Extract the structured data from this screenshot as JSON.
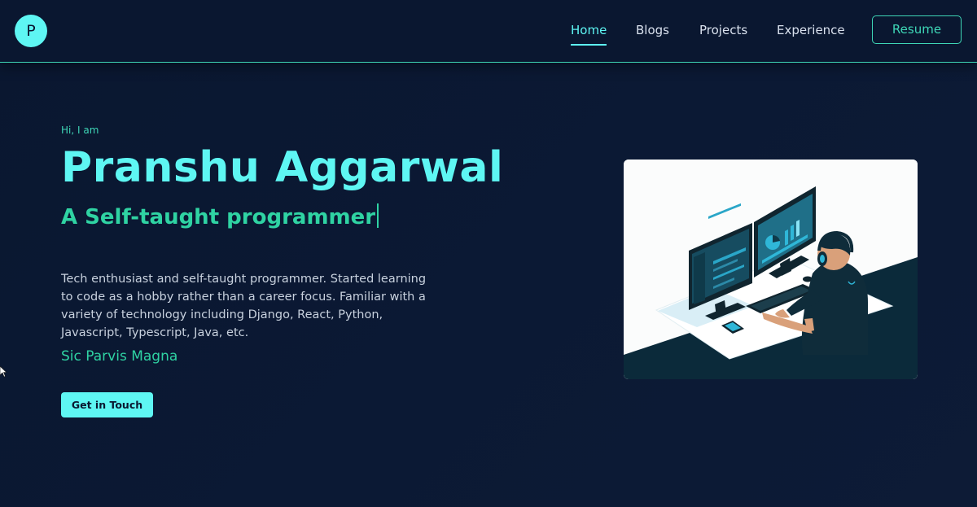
{
  "header": {
    "logo_letter": "P",
    "nav": [
      {
        "label": "Home",
        "active": true
      },
      {
        "label": "Blogs",
        "active": false
      },
      {
        "label": "Projects",
        "active": false
      },
      {
        "label": "Experience",
        "active": false
      }
    ],
    "resume_label": "Resume"
  },
  "hero": {
    "greeting": "Hi, I am",
    "name": "Pranshu Aggarwal",
    "tagline": "A Self-taught programmer",
    "bio": "Tech enthusiast and self-taught programmer. Started learning to code as a hobby rather than a career focus. Familiar with a variety of technology including Django, React, Python, Javascript, Typescript, Java, etc.",
    "motto": "Sic Parvis Magna",
    "cta_label": "Get in Touch"
  },
  "colors": {
    "background": "#0b1832",
    "accent_cyan": "#5ef6f3",
    "accent_green": "#2fd3a3",
    "text_muted": "#c8d1de",
    "illustration_dark": "#0b2a3a"
  },
  "illustration": {
    "icon": "programmer-at-desk-illustration"
  }
}
